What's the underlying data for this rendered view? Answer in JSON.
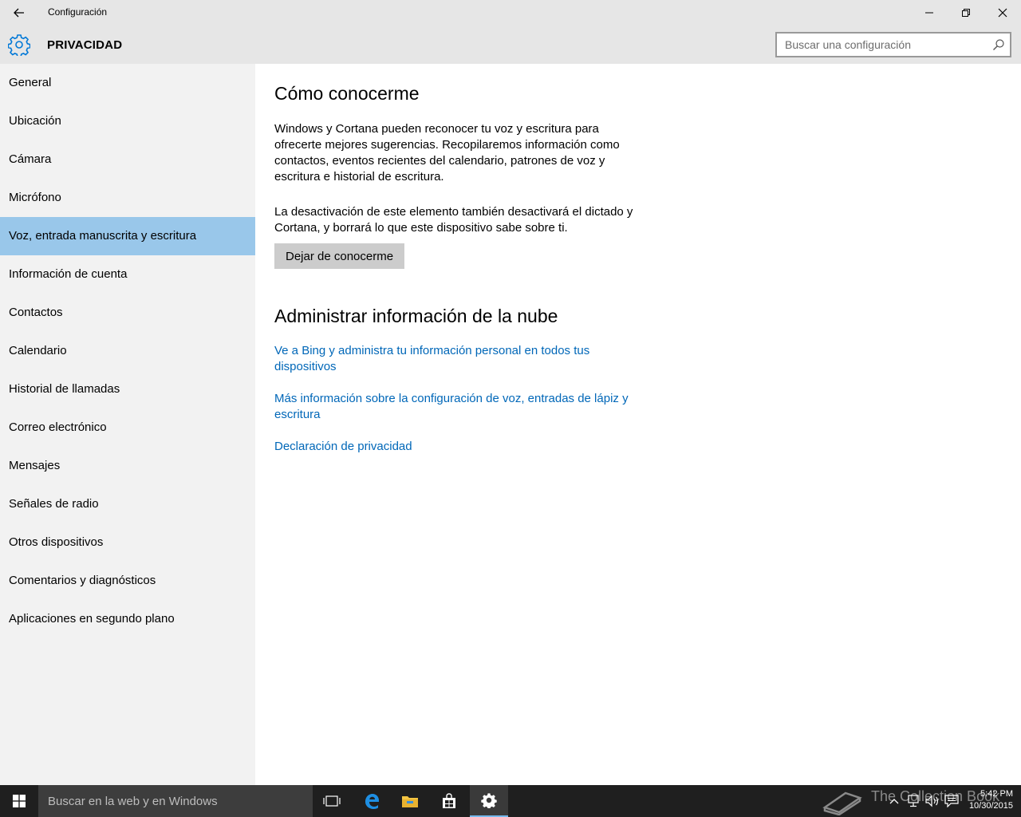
{
  "window": {
    "title": "Configuración"
  },
  "header": {
    "title": "PRIVACIDAD",
    "search_placeholder": "Buscar una configuración"
  },
  "sidebar": {
    "items": [
      {
        "label": "General"
      },
      {
        "label": "Ubicación"
      },
      {
        "label": "Cámara"
      },
      {
        "label": "Micrófono"
      },
      {
        "label": "Voz, entrada manuscrita y escritura",
        "selected": true
      },
      {
        "label": "Información de cuenta"
      },
      {
        "label": "Contactos"
      },
      {
        "label": "Calendario"
      },
      {
        "label": "Historial de llamadas"
      },
      {
        "label": "Correo electrónico"
      },
      {
        "label": "Mensajes"
      },
      {
        "label": "Señales de radio"
      },
      {
        "label": "Otros dispositivos"
      },
      {
        "label": "Comentarios y diagnósticos"
      },
      {
        "label": "Aplicaciones en segundo plano"
      }
    ]
  },
  "main": {
    "section1": {
      "title": "Cómo conocerme",
      "para1": "Windows y Cortana pueden reconocer tu voz y escritura para ofrecerte mejores sugerencias. Recopilaremos información como contactos, eventos recientes del calendario, patrones de voz y escritura e historial de escritura.",
      "para2": "La desactivación de este elemento también desactivará el dictado y Cortana, y borrará lo que este dispositivo sabe sobre ti.",
      "button_label": "Dejar de conocerme"
    },
    "section2": {
      "title": "Administrar información de la nube",
      "links": [
        {
          "label": "Ve a Bing y administra tu información personal en todos tus dispositivos"
        },
        {
          "label": "Más información sobre la configuración de voz, entradas de lápiz y escritura"
        },
        {
          "label": "Declaración de privacidad"
        }
      ]
    }
  },
  "taskbar": {
    "search_placeholder": "Buscar en la web y en Windows",
    "clock_time": "5:42 PM",
    "clock_date": "10/30/2015",
    "watermark": "The Collection Book"
  },
  "colors": {
    "accent": "#0078d7",
    "selected_nav": "#99c7ea",
    "link": "#0067b8"
  }
}
